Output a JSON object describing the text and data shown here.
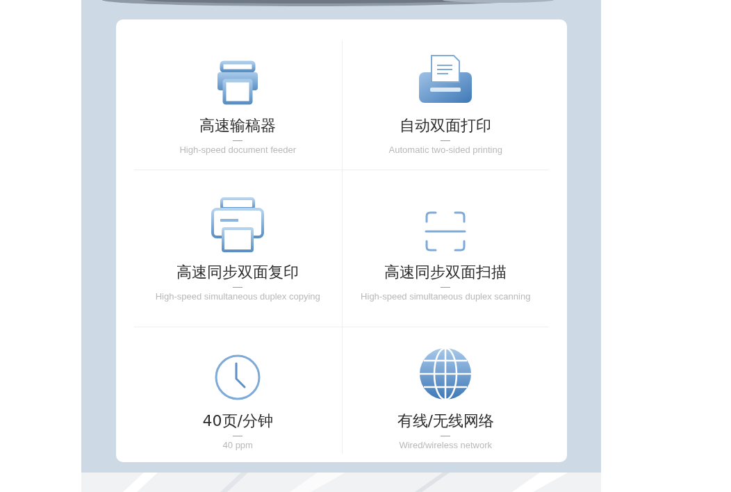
{
  "features": [
    {
      "title": "高速输稿器",
      "subtitle": "High-speed document feeder"
    },
    {
      "title": "自动双面打印",
      "subtitle": "Automatic two-sided printing"
    },
    {
      "title": "高速同步双面复印",
      "subtitle": "High-speed simultaneous duplex copying"
    },
    {
      "title": "高速同步双面扫描",
      "subtitle": "High-speed simultaneous duplex scanning"
    },
    {
      "title": "40页/分钟",
      "subtitle": "40 ppm"
    },
    {
      "title": "有线/无线网络",
      "subtitle": "Wired/wireless network"
    }
  ]
}
